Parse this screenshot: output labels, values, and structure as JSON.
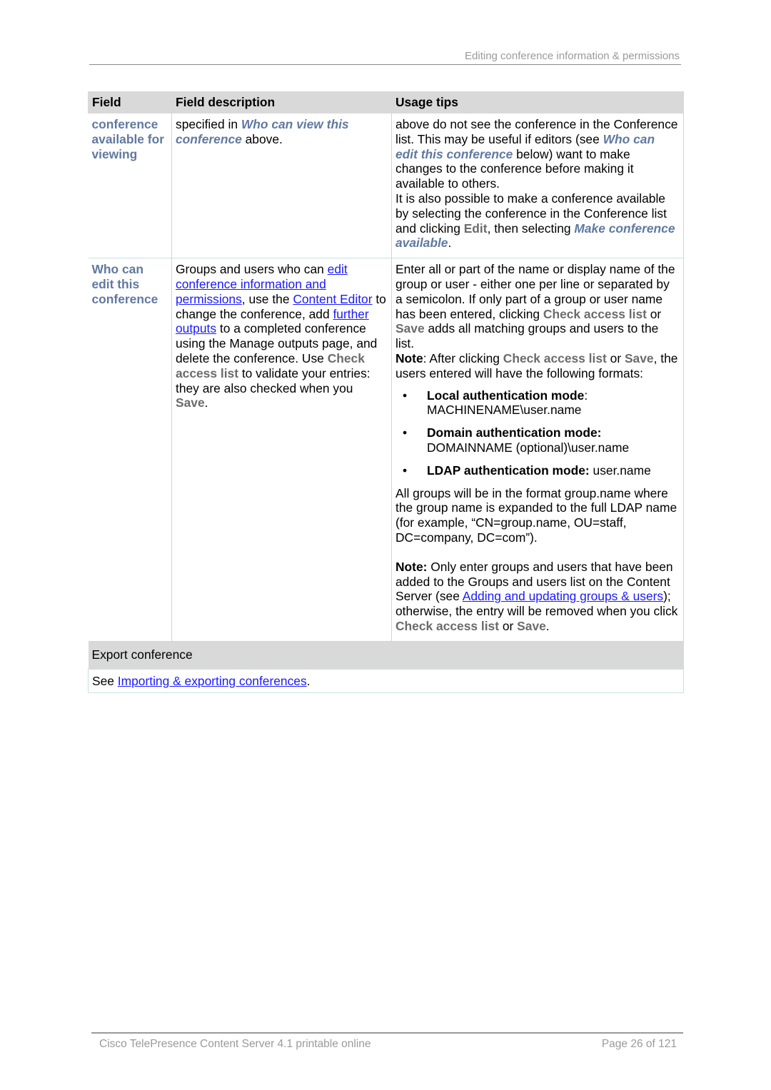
{
  "header": {
    "section_title": "Editing conference information & permissions"
  },
  "table": {
    "columns": [
      "Field",
      "Field description",
      "Usage tips"
    ],
    "row1": {
      "field": "conference available for viewing",
      "desc": {
        "t1": "specified in ",
        "ref1": "Who can view this conference",
        "t2": " above."
      },
      "tips": {
        "t1": "above do not see the conference in the Conference list. This may be useful if editors (see ",
        "ref1": "Who can edit this conference",
        "t2": " below) want to make changes to the conference before making it available to others.",
        "t3": "It is also possible to make a conference available by selecting the conference in the Conference list and clicking ",
        "ui1": "Edit",
        "t4": ", then selecting ",
        "ref2": "Make conference available",
        "t5": "."
      }
    },
    "row2": {
      "field": "Who can edit this conference",
      "desc": {
        "t1": "Groups and users who can ",
        "link1": "edit conference information and permissions",
        "t2": ", use the ",
        "link2": "Content Editor",
        "t3": " to change the conference, add ",
        "link3": "further outputs",
        "t4": " to a completed conference using the Manage outputs page, and delete the conference. Use ",
        "ui1": "Check access list",
        "t5": " to validate your entries: they are also checked when you ",
        "ui2": "Save",
        "t6": "."
      },
      "tips": {
        "p1": {
          "t1": "Enter all or part of the name or display name of the group or user - either one per line or separated by a semicolon. If only part of a group or user name has been entered, clicking ",
          "ui1": "Check access list",
          "t2": " or ",
          "ui2": "Save",
          "t3": " adds all matching groups and users to the list."
        },
        "p2": {
          "note": "Note",
          "t1": ": After clicking ",
          "ui1": "Check access list",
          "t2": " or ",
          "ui2": "Save",
          "t3": ", the users entered will have the following formats:"
        },
        "modes": [
          {
            "label": "Local authentication mode",
            "sep": ":",
            "value": "MACHINENAME\\user.name"
          },
          {
            "label": "Domain authentication mode:",
            "sep": "",
            "value": "DOMAINNAME (optional)\\user.name"
          },
          {
            "label": "LDAP authentication mode:",
            "sep": "",
            "value": " user.name"
          }
        ],
        "p3": "All groups will be in the format group.name where the group name is expanded to the full LDAP name (for example, “CN=group.name, OU=staff, DC=company, DC=com”).",
        "p4": {
          "note": "Note:",
          "t1": " Only enter groups and users that have been added to the Groups and users list on the Content Server (see ",
          "link1": "Adding and updating groups & users",
          "t2": "); otherwise, the entry will be removed when you click ",
          "ui1": "Check access list",
          "t3": " or ",
          "ui2": "Save",
          "t4": "."
        }
      }
    }
  },
  "export": {
    "title": "Export conference",
    "t1": "See ",
    "link": "Importing & exporting conferences",
    "t2": "."
  },
  "footer": {
    "doc_title": "Cisco TelePresence Content Server 4.1 printable online",
    "page": "Page 26 of 121"
  },
  "colors": {
    "field_name": "#6079a0",
    "ui_label": "#6b6b6b",
    "link": "#1a1aff",
    "header_bg": "#d9d9d9"
  }
}
